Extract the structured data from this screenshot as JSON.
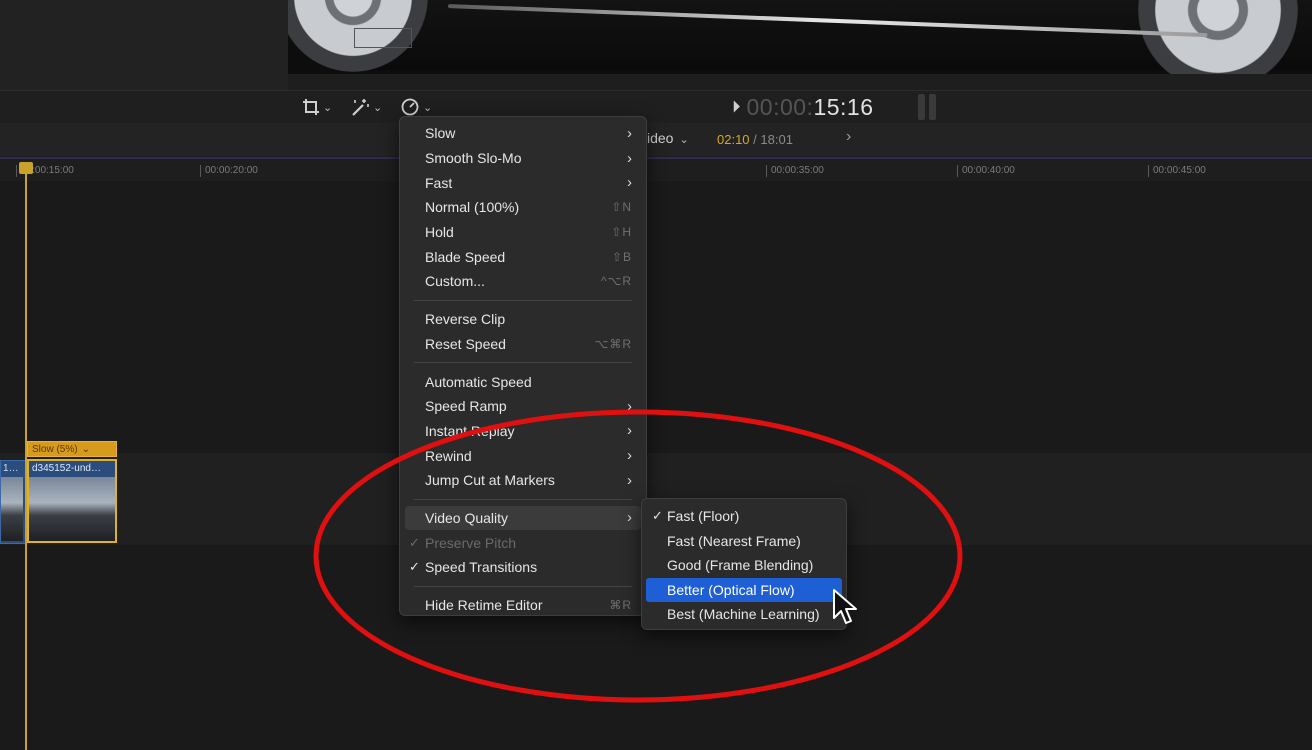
{
  "toolbar": {
    "timecode_dim": "00:00:",
    "timecode_main": "15:16"
  },
  "timeline": {
    "project_label": "ideo",
    "current_time": "02:10",
    "duration": "/ 18:01",
    "ruler_ticks": [
      "00:00:15:00",
      "00:00:20:00",
      "00:00:35:00",
      "00:00:40:00",
      "00:00:45:00"
    ],
    "clip_left_title": "1…",
    "speed_tag": "Slow (5%)",
    "clip_title": "d345152-und…"
  },
  "retime_menu": {
    "items": [
      {
        "label": "Slow",
        "submenu": true
      },
      {
        "label": "Smooth Slo-Mo",
        "submenu": true
      },
      {
        "label": "Fast",
        "submenu": true
      },
      {
        "label": "Normal (100%)",
        "shortcut": "⇧N"
      },
      {
        "label": "Hold",
        "shortcut": "⇧H"
      },
      {
        "label": "Blade Speed",
        "shortcut": "⇧B"
      },
      {
        "label": "Custom...",
        "shortcut": "^⌥R"
      },
      {
        "label": "Reverse Clip"
      },
      {
        "label": "Reset Speed",
        "shortcut": "⌥⌘R"
      },
      {
        "label": "Automatic Speed"
      },
      {
        "label": "Speed Ramp",
        "submenu": true
      },
      {
        "label": "Instant Replay",
        "submenu": true
      },
      {
        "label": "Rewind",
        "submenu": true
      },
      {
        "label": "Jump Cut at Markers",
        "submenu": true
      },
      {
        "label": "Video Quality",
        "submenu": true,
        "active": true
      },
      {
        "label": "Preserve Pitch",
        "checked": true,
        "disabled": true
      },
      {
        "label": "Speed Transitions",
        "checked": true
      },
      {
        "label": "Hide Retime Editor",
        "shortcut": "⌘R"
      }
    ]
  },
  "video_quality_menu": {
    "items": [
      {
        "label": "Fast (Floor)",
        "checked": true
      },
      {
        "label": "Fast (Nearest Frame)"
      },
      {
        "label": "Good (Frame Blending)"
      },
      {
        "label": "Better (Optical Flow)",
        "highlighted": true
      },
      {
        "label": "Best (Machine Learning)"
      }
    ]
  },
  "colors": {
    "highlight": "#1f5fd6",
    "annotation": "#e01010",
    "playhead": "#c8a22a"
  }
}
